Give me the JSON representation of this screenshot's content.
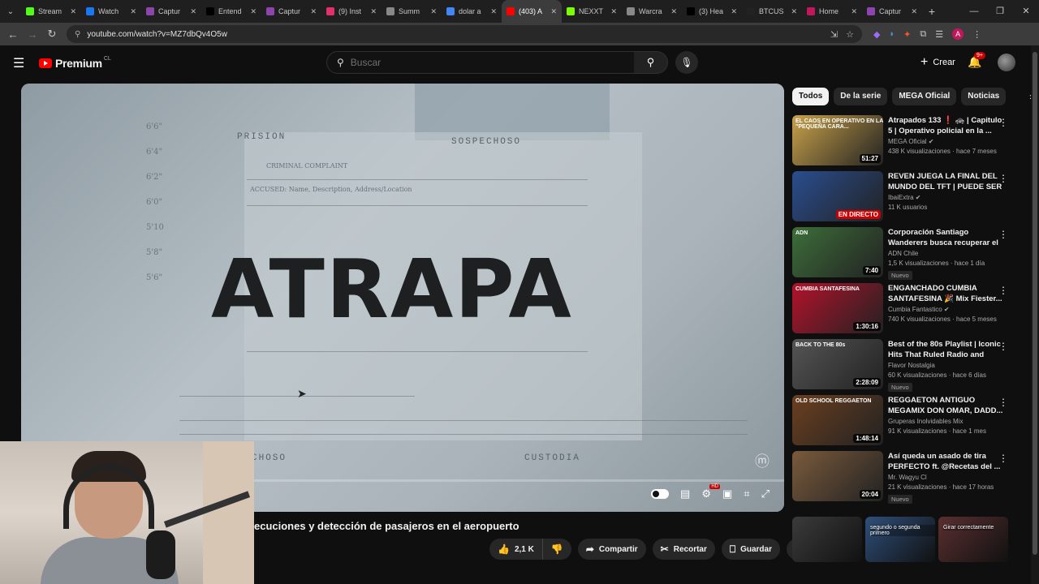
{
  "browser": {
    "tabs": [
      {
        "label": "Stream",
        "color": "#53fc18"
      },
      {
        "label": "Watch",
        "color": "#1877f2"
      },
      {
        "label": "Captur",
        "color": "#8e44ad"
      },
      {
        "label": "Entend",
        "color": "#000000"
      },
      {
        "label": "Captur",
        "color": "#8e44ad"
      },
      {
        "label": "(9) Inst",
        "color": "#e1306c"
      },
      {
        "label": "Summ",
        "color": "#888888"
      },
      {
        "label": "dolar a",
        "color": "#4285f4"
      },
      {
        "label": "(403) A",
        "color": "#ff0000"
      },
      {
        "label": "NEXXT",
        "color": "#7cfc00"
      },
      {
        "label": "Warcra",
        "color": "#888888"
      },
      {
        "label": "(3) Hea",
        "color": "#000000"
      },
      {
        "label": "BTCUS",
        "color": "#222222"
      },
      {
        "label": "Home",
        "color": "#c2185b"
      },
      {
        "label": "Captur",
        "color": "#8e44ad"
      }
    ],
    "active_tab_index": 8,
    "url": "youtube.com/watch?v=MZ7dbQv4O5w",
    "profile_initial": "A"
  },
  "youtube": {
    "logo_text": "Premium",
    "country_code": "CL",
    "search_placeholder": "Buscar",
    "create_label": "Crear",
    "notification_count": "9+"
  },
  "player": {
    "title_art": "ATRAPA",
    "doc_words": {
      "prision": "PRISION",
      "sospechoso": "SOSPECHOSO",
      "complaint": "CRIMINAL COMPLAINT",
      "accused": "ACCUSED: Name, Description, Address/Location",
      "choso": "CHOSO",
      "custodia": "CUSTODIA"
    },
    "height_scale": [
      "6'6\"",
      "6'4\"",
      "6'2\"",
      "6'0\"",
      "5'10",
      "5'8\"",
      "5'6\""
    ],
    "progress_fraction": 0.0
  },
  "video": {
    "title": "ecuciones y detección de pasajeros en el aeropuerto",
    "likes": "2,1 K",
    "share_label": "Compartir",
    "clip_label": "Recortar",
    "save_label": "Guardar"
  },
  "sidebar": {
    "chips": [
      "Todos",
      "De la serie",
      "MEGA Oficial",
      "Noticias"
    ],
    "recommendations": [
      {
        "title": "Atrapados 133 ❗ 🚓 | Capitulo 5 | Operativo policial en la ...",
        "channel": "MEGA Oficial",
        "verified": true,
        "meta": "438 K visualizaciones · hace 7 meses",
        "duration": "51:27",
        "badge": "",
        "thumb_text": "EL CAOS EN OPERATIVO EN LA \"PEQUEÑA CARA...",
        "thumb_color": "#c9a24a"
      },
      {
        "title": "REVEN JUEGA LA FINAL DEL MUNDO DEL TFT | PUEDE SER ...",
        "channel": "IbaiExtra",
        "verified": true,
        "meta": "11 K usuarios",
        "duration": "EN DIRECTO",
        "badge": "",
        "thumb_text": "",
        "thumb_color": "#2a4d8f"
      },
      {
        "title": "Corporación Santiago Wanderers busca recuperar el ...",
        "channel": "ADN Chile",
        "verified": false,
        "meta": "1,5 K visualizaciones · hace 1 día",
        "duration": "7:40",
        "badge": "Nuevo",
        "thumb_text": "ADN",
        "thumb_color": "#3d6e3a"
      },
      {
        "title": "ENGANCHADO CUMBIA SANTAFESINA 🎉 Mix Fiester...",
        "channel": "Cumbia Fantastico",
        "verified": true,
        "meta": "740 K visualizaciones · hace 5 meses",
        "duration": "1:30:16",
        "badge": "",
        "thumb_text": "CUMBIA SANTAFESINA",
        "thumb_color": "#b3122b"
      },
      {
        "title": "Best of the 80s Playlist | Iconic Hits That Ruled Radio and Pop...",
        "channel": "Flavor Nostalgia",
        "verified": false,
        "meta": "60 K visualizaciones · hace 6 días",
        "duration": "2:28:09",
        "badge": "Nuevo",
        "thumb_text": "BACK TO THE 80s",
        "thumb_color": "#555555"
      },
      {
        "title": "REGGAETON ANTIGUO MEGAMIX DON OMAR, DADD...",
        "channel": "Gruperas Inolvidables Mix",
        "verified": false,
        "meta": "91 K visualizaciones · hace 1 mes",
        "duration": "1:48:14",
        "badge": "",
        "thumb_text": "OLD SCHOOL REGGAETON",
        "thumb_color": "#6b3f1f"
      },
      {
        "title": "Así queda un asado de tira PERFECTO ft. @Recetas del ...",
        "channel": "Mr. Wagyu Cl",
        "verified": false,
        "meta": "21 K visualizaciones · hace 17 horas",
        "duration": "20:04",
        "badge": "Nuevo",
        "thumb_text": "",
        "thumb_color": "#7a5a3c"
      }
    ],
    "shorts": [
      {
        "text": "",
        "color": "#3b3b3b"
      },
      {
        "text": "segundo o segunda primero",
        "color": "#2f4f7a"
      },
      {
        "text": "Girar correctamente",
        "color": "#5a2f2f"
      }
    ]
  }
}
